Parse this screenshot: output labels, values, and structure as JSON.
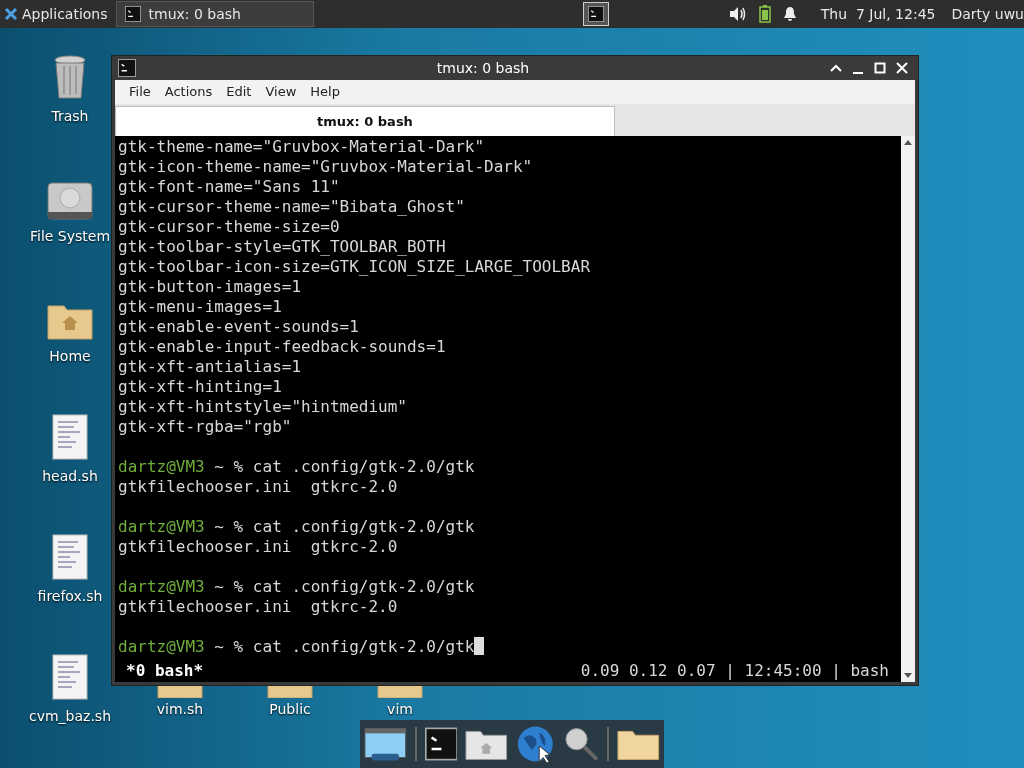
{
  "top_panel": {
    "apps_menu": "Applications",
    "tasks": [
      {
        "label": "tmux: 0 bash",
        "selected": true
      }
    ],
    "clock": "Thu  7 Jul, 12:45",
    "user": "Darty uwu"
  },
  "desktop_icons": [
    {
      "label": "Trash",
      "kind": "trash"
    },
    {
      "label": "File System",
      "kind": "drive"
    },
    {
      "label": "Home",
      "kind": "home"
    },
    {
      "label": "head.sh",
      "kind": "script"
    },
    {
      "label": "firefox.sh",
      "kind": "script"
    },
    {
      "label": "cvm_baz.sh",
      "kind": "script"
    }
  ],
  "bottom_icons": [
    {
      "label": "vim.sh"
    },
    {
      "label": "Public"
    },
    {
      "label": "vim"
    }
  ],
  "window": {
    "title": "tmux: 0 bash",
    "menu": [
      "File",
      "Actions",
      "Edit",
      "View",
      "Help"
    ],
    "tabs": [
      {
        "label": "tmux: 0 bash",
        "selected": true
      }
    ],
    "lines": [
      {
        "kind": "output",
        "text": "gtk-theme-name=\"Gruvbox-Material-Dark\""
      },
      {
        "kind": "output",
        "text": "gtk-icon-theme-name=\"Gruvbox-Material-Dark\""
      },
      {
        "kind": "output",
        "text": "gtk-font-name=\"Sans 11\""
      },
      {
        "kind": "output",
        "text": "gtk-cursor-theme-name=\"Bibata_Ghost\""
      },
      {
        "kind": "output",
        "text": "gtk-cursor-theme-size=0"
      },
      {
        "kind": "output",
        "text": "gtk-toolbar-style=GTK_TOOLBAR_BOTH"
      },
      {
        "kind": "output",
        "text": "gtk-toolbar-icon-size=GTK_ICON_SIZE_LARGE_TOOLBAR"
      },
      {
        "kind": "output",
        "text": "gtk-button-images=1"
      },
      {
        "kind": "output",
        "text": "gtk-menu-images=1"
      },
      {
        "kind": "output",
        "text": "gtk-enable-event-sounds=1"
      },
      {
        "kind": "output",
        "text": "gtk-enable-input-feedback-sounds=1"
      },
      {
        "kind": "output",
        "text": "gtk-xft-antialias=1"
      },
      {
        "kind": "output",
        "text": "gtk-xft-hinting=1"
      },
      {
        "kind": "output",
        "text": "gtk-xft-hintstyle=\"hintmedium\""
      },
      {
        "kind": "output",
        "text": "gtk-xft-rgba=\"rgb\""
      },
      {
        "kind": "prompt",
        "user": "dartz@VM3",
        "text": " ~ % cat .config/gtk-2.0/gtk",
        "cursor": false
      },
      {
        "kind": "output",
        "text": "gtkfilechooser.ini  gtkrc-2.0"
      },
      {
        "kind": "prompt",
        "user": "dartz@VM3",
        "text": " ~ % cat .config/gtk-2.0/gtk",
        "cursor": false
      },
      {
        "kind": "output",
        "text": "gtkfilechooser.ini  gtkrc-2.0"
      },
      {
        "kind": "prompt",
        "user": "dartz@VM3",
        "text": " ~ % cat .config/gtk-2.0/gtk",
        "cursor": false
      },
      {
        "kind": "output",
        "text": "gtkfilechooser.ini  gtkrc-2.0"
      },
      {
        "kind": "prompt",
        "user": "dartz@VM3",
        "text": " ~ % cat .config/gtk-2.0/gtk",
        "cursor": true
      }
    ],
    "status_left": "*0 bash*",
    "status_right": "0.09 0.12 0.07 | 12:45:00 | bash"
  }
}
